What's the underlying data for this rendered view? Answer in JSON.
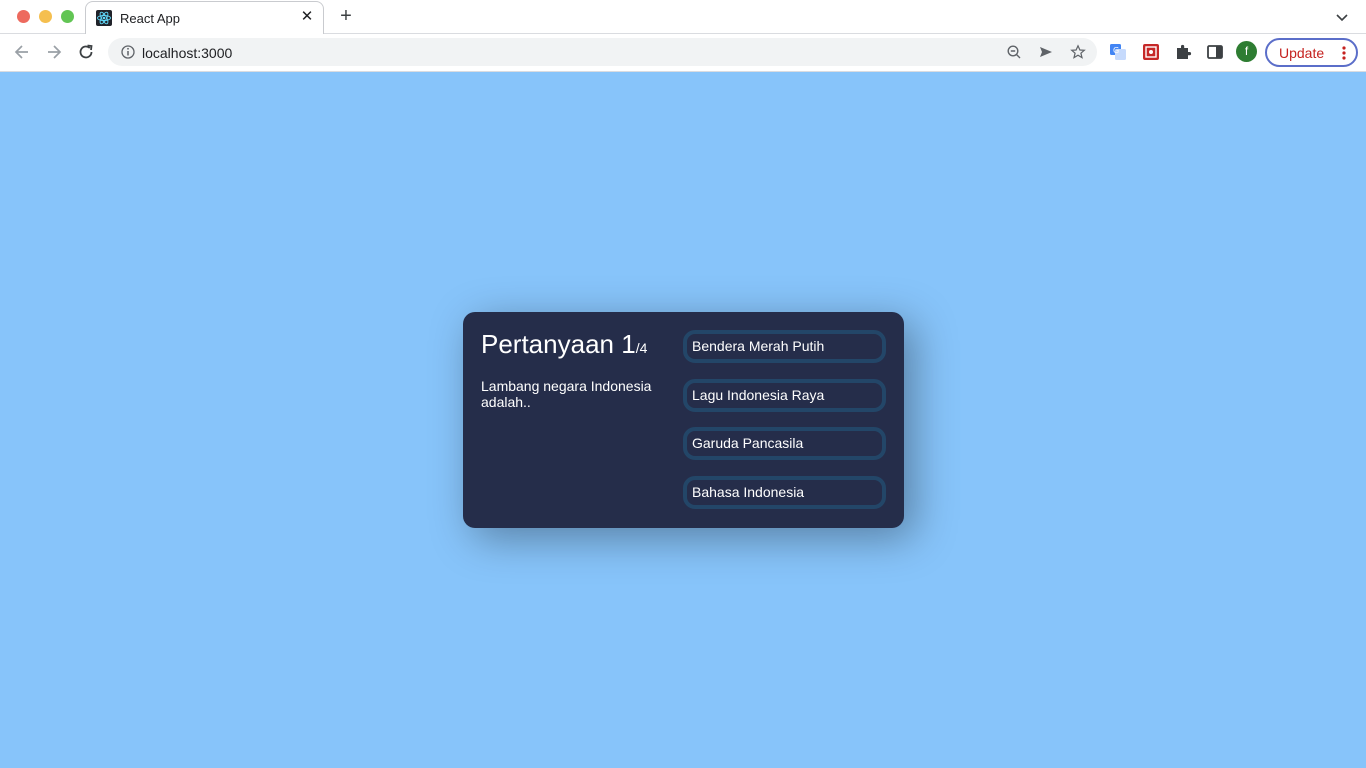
{
  "browser": {
    "tab_title": "React App",
    "url": "localhost:3000",
    "update_label": "Update",
    "profile_initial": "f",
    "colors": {
      "update_text": "#c5221f",
      "update_border": "#5b6ec9",
      "avatar": "#2e7d32"
    }
  },
  "page": {
    "background_color": "#87c4fa",
    "card_color": "#252d4a",
    "quiz": {
      "title_prefix": "Pertanyaan ",
      "current": "1",
      "total": "/4",
      "question": "Lambang negara Indonesia adalah..",
      "answers": [
        {
          "label": "Bendera Merah Putih"
        },
        {
          "label": "Lagu Indonesia Raya"
        },
        {
          "label": "Garuda Pancasila"
        },
        {
          "label": "Bahasa Indonesia"
        }
      ]
    }
  }
}
